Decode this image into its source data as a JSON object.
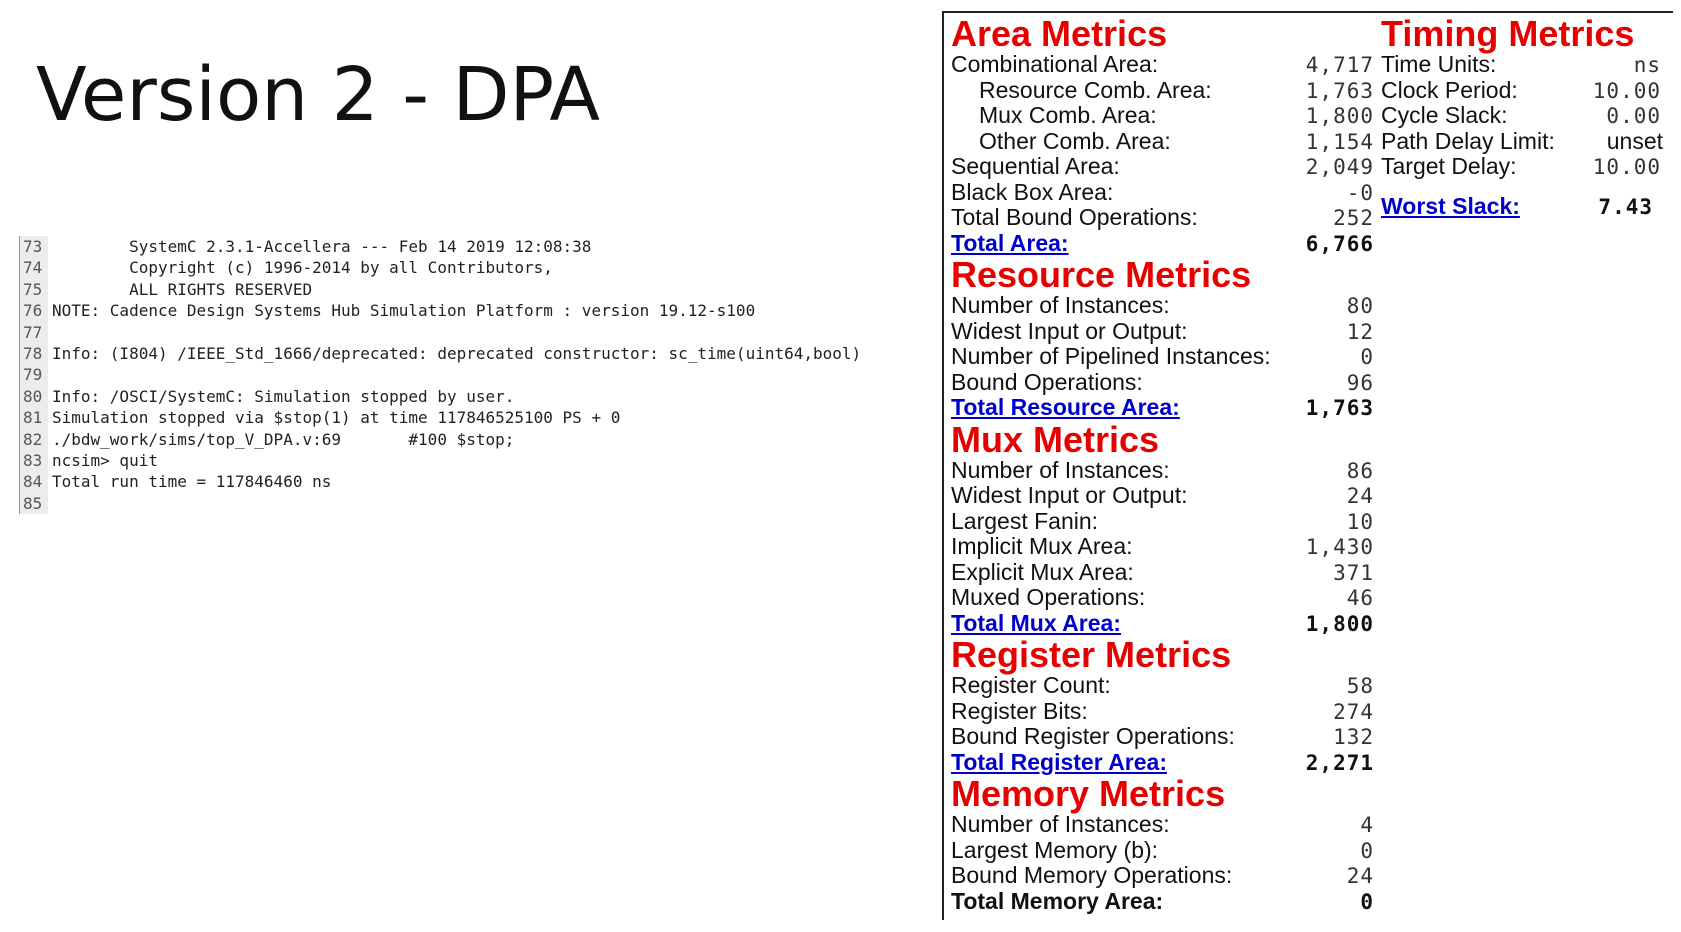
{
  "slide": {
    "title": "Version 2 - DPA"
  },
  "console": {
    "lines": [
      {
        "num": "73",
        "text": "        SystemC 2.3.1-Accellera --- Feb 14 2019 12:08:38"
      },
      {
        "num": "74",
        "text": "        Copyright (c) 1996-2014 by all Contributors,"
      },
      {
        "num": "75",
        "text": "        ALL RIGHTS RESERVED"
      },
      {
        "num": "76",
        "text": "NOTE: Cadence Design Systems Hub Simulation Platform : version 19.12-s100"
      },
      {
        "num": "77",
        "text": ""
      },
      {
        "num": "78",
        "text": "Info: (I804) /IEEE_Std_1666/deprecated: deprecated constructor: sc_time(uint64,bool)"
      },
      {
        "num": "79",
        "text": ""
      },
      {
        "num": "80",
        "text": "Info: /OSCI/SystemC: Simulation stopped by user."
      },
      {
        "num": "81",
        "text": "Simulation stopped via $stop(1) at time 117846525100 PS + 0"
      },
      {
        "num": "82",
        "text": "./bdw_work/sims/top_V_DPA.v:69       #100 $stop;"
      },
      {
        "num": "83",
        "text": "ncsim> quit"
      },
      {
        "num": "84",
        "text": "Total run time = 117846460 ns"
      },
      {
        "num": "85",
        "text": ""
      }
    ]
  },
  "area": {
    "title": "Area Metrics",
    "rows": [
      {
        "label": "Combinational Area:",
        "value": "4,717"
      },
      {
        "label": "Resource Comb. Area:",
        "value": "1,763"
      },
      {
        "label": "Mux Comb. Area:",
        "value": "1,800"
      },
      {
        "label": "Other Comb. Area:",
        "value": "1,154"
      },
      {
        "label": "Sequential Area:",
        "value": "2,049"
      },
      {
        "label": "Black Box Area:",
        "value": "-0"
      },
      {
        "label": "Total Bound Operations:",
        "value": "252"
      }
    ],
    "total_label": "Total Area:",
    "total_value": "6,766"
  },
  "resource": {
    "title": "Resource Metrics",
    "rows": [
      {
        "label": "Number of Instances:",
        "value": "80"
      },
      {
        "label": "Widest Input or Output:",
        "value": "12"
      },
      {
        "label": "Number of Pipelined Instances:",
        "value": "0"
      },
      {
        "label": "Bound Operations:",
        "value": "96"
      }
    ],
    "total_label": "Total Resource Area:",
    "total_value": "1,763"
  },
  "mux": {
    "title": "Mux Metrics",
    "rows": [
      {
        "label": "Number of Instances:",
        "value": "86"
      },
      {
        "label": "Widest Input or Output:",
        "value": "24"
      },
      {
        "label": "Largest Fanin:",
        "value": "10"
      },
      {
        "label": "Implicit Mux Area:",
        "value": "1,430"
      },
      {
        "label": "Explicit Mux Area:",
        "value": "371"
      },
      {
        "label": "Muxed Operations:",
        "value": "46"
      }
    ],
    "total_label": "Total Mux Area:",
    "total_value": "1,800"
  },
  "register": {
    "title": "Register Metrics",
    "rows": [
      {
        "label": "Register Count:",
        "value": "58"
      },
      {
        "label": "Register Bits:",
        "value": "274"
      },
      {
        "label": "Bound Register Operations:",
        "value": "132"
      }
    ],
    "total_label": "Total Register Area:",
    "total_value": "2,271"
  },
  "memory": {
    "title": "Memory Metrics",
    "rows": [
      {
        "label": "Number of Instances:",
        "value": "4"
      },
      {
        "label": "Largest Memory (b):",
        "value": "0"
      },
      {
        "label": "Bound Memory Operations:",
        "value": "24"
      }
    ],
    "total_label": "Total Memory Area:",
    "total_value": "0"
  },
  "timing": {
    "title": "Timing Metrics",
    "rows": [
      {
        "label": "Time Units:",
        "value": "ns"
      },
      {
        "label": "Clock Period:",
        "value": "10.00"
      },
      {
        "label": "Cycle Slack:",
        "value": "0.00"
      },
      {
        "label": "Path Delay Limit:",
        "value": "unset"
      },
      {
        "label": "Target Delay:",
        "value": "10.00"
      }
    ],
    "worst_label": "Worst Slack:",
    "worst_value": "7.43"
  },
  "colors": {
    "section_title": "#e60000",
    "link": "#0000cc"
  }
}
